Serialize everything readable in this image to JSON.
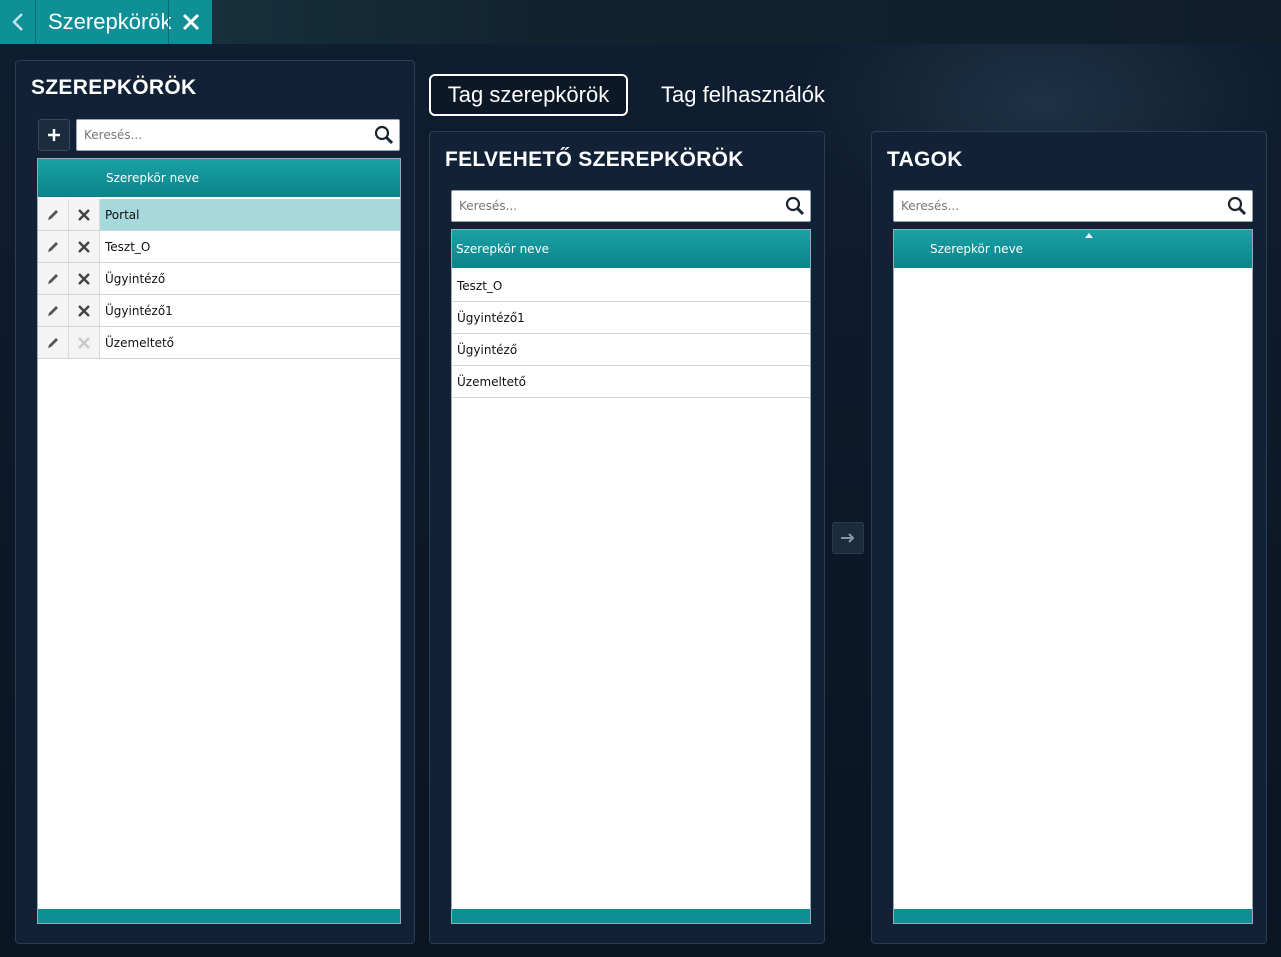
{
  "window": {
    "tab_title": "Szerepkörök"
  },
  "tabs": [
    {
      "label": "Tag szerepkörök",
      "active": true
    },
    {
      "label": "Tag felhasználók",
      "active": false
    }
  ],
  "left_panel": {
    "title": "SZEREPKÖRÖK",
    "search_placeholder": "Keresés...",
    "column_header": "Szerepkör neve",
    "rows": [
      {
        "name": "Portal",
        "selected": true,
        "deletable": true
      },
      {
        "name": "Teszt_O",
        "selected": false,
        "deletable": true
      },
      {
        "name": "Ügyintéző",
        "selected": false,
        "deletable": true
      },
      {
        "name": "Ügyintéző1",
        "selected": false,
        "deletable": true
      },
      {
        "name": "Üzemeltető",
        "selected": false,
        "deletable": false
      }
    ]
  },
  "middle_panel": {
    "title": "FELVEHETŐ SZEREPKÖRÖK",
    "search_placeholder": "Keresés...",
    "column_header": "Szerepkör neve",
    "rows": [
      "Teszt_O",
      "Ügyintéző1",
      "Ügyintéző",
      "Üzemeltető"
    ]
  },
  "right_panel": {
    "title": "TAGOK",
    "search_placeholder": "Keresés...",
    "column_header": "Szerepkör neve",
    "sort": "ascending",
    "rows": []
  },
  "colors": {
    "accent": "#0f8f96",
    "panel_bg": "#112237",
    "selected_row": "#a6d8dc"
  },
  "icons": {
    "back": "chevron-left-icon",
    "close": "close-icon",
    "add": "plus-icon",
    "search": "search-icon",
    "edit": "pencil-icon",
    "delete": "x-icon",
    "move": "arrow-right-icon"
  }
}
